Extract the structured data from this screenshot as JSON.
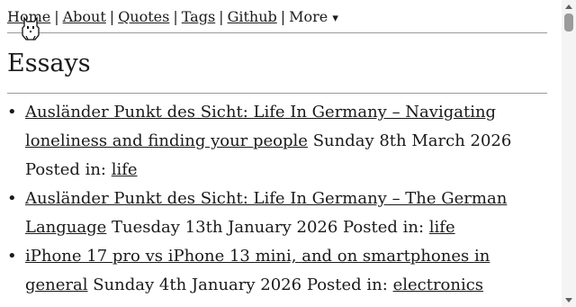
{
  "nav": {
    "home": "Home",
    "about": "About",
    "quotes": "Quotes",
    "tags": "Tags",
    "github": "Github",
    "more": "More",
    "separator": "|",
    "more_icon": "chevron-down-icon"
  },
  "heading": "Essays",
  "posts": [
    {
      "title": "Ausländer Punkt des Sicht: Life In Germany – Navigating loneliness and finding your people",
      "date": "Sunday 8th March 2026",
      "posted_in": "Posted in:",
      "tag": "life"
    },
    {
      "title": "Ausländer Punkt des Sicht: Life In Germany – The German Language",
      "date": "Tuesday 13th January 2026",
      "posted_in": "Posted in:",
      "tag": "life"
    },
    {
      "title": "iPhone 17 pro vs iPhone 13 mini, and on smartphones in general",
      "date": "Sunday 4th January 2026",
      "posted_in": "Posted in:",
      "tag": "electronics"
    }
  ]
}
